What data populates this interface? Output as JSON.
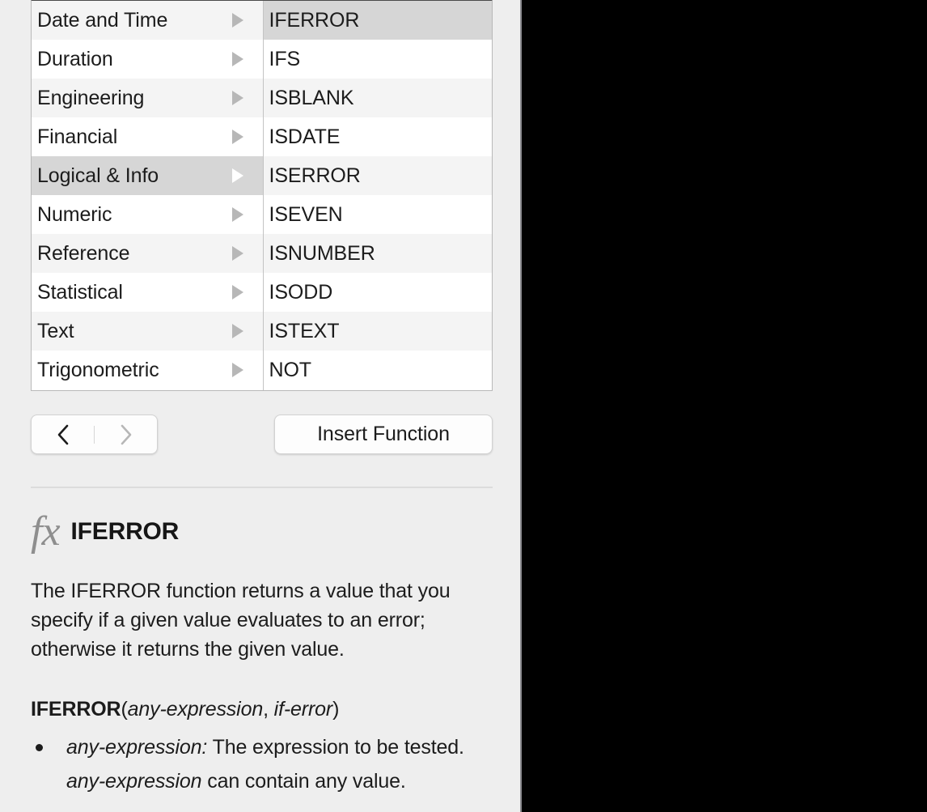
{
  "panel": {
    "name": "Function Browser"
  },
  "category_list": {
    "name": "Function categories",
    "selected": "Logical & Info",
    "disclosure_icon": "triangle-right-icon",
    "items": [
      {
        "label": "Date and Time",
        "selected": false
      },
      {
        "label": "Duration",
        "selected": false
      },
      {
        "label": "Engineering",
        "selected": false
      },
      {
        "label": "Financial",
        "selected": false
      },
      {
        "label": "Logical & Info",
        "selected": true
      },
      {
        "label": "Numeric",
        "selected": false
      },
      {
        "label": "Reference",
        "selected": false
      },
      {
        "label": "Statistical",
        "selected": false
      },
      {
        "label": "Text",
        "selected": false
      },
      {
        "label": "Trigonometric",
        "selected": false
      }
    ]
  },
  "function_list": {
    "name": "Functions in Logical & Info",
    "selected": "IFERROR",
    "items": [
      {
        "label": "IFERROR",
        "selected": true
      },
      {
        "label": "IFS",
        "selected": false
      },
      {
        "label": "ISBLANK",
        "selected": false
      },
      {
        "label": "ISDATE",
        "selected": false
      },
      {
        "label": "ISERROR",
        "selected": false
      },
      {
        "label": "ISEVEN",
        "selected": false
      },
      {
        "label": "ISNUMBER",
        "selected": false
      },
      {
        "label": "ISODD",
        "selected": false
      },
      {
        "label": "ISTEXT",
        "selected": false
      },
      {
        "label": "NOT",
        "selected": false
      }
    ]
  },
  "controls": {
    "back_icon": "chevron-left-icon",
    "forward_icon": "chevron-right-icon",
    "back_enabled": true,
    "forward_enabled": false,
    "insert_function_label": "Insert Function"
  },
  "detail": {
    "fx_icon_text": "fx",
    "function_name": "IFERROR",
    "description": "The IFERROR function returns a value that you specify if a given value evaluates to an error; otherwise it returns the given value.",
    "syntax": {
      "function_name": "IFERROR",
      "open_paren": "(",
      "param1": "any-expression",
      "separator": ", ",
      "param2": "if-error",
      "close_paren": ")"
    },
    "arguments": [
      {
        "term": "any-expression:",
        "text_before_emphasis": " The expression to be tested. ",
        "emphasis": "any-expression",
        "text_after_emphasis": " can contain any value."
      }
    ]
  },
  "colors": {
    "panel_background": "#eeeeee",
    "row_alt": "#f4f4f4",
    "row_plain": "#ffffff",
    "row_selected": "#d6d6d6",
    "text": "#1c1c1c",
    "disclosure": "#b7b7b7"
  }
}
